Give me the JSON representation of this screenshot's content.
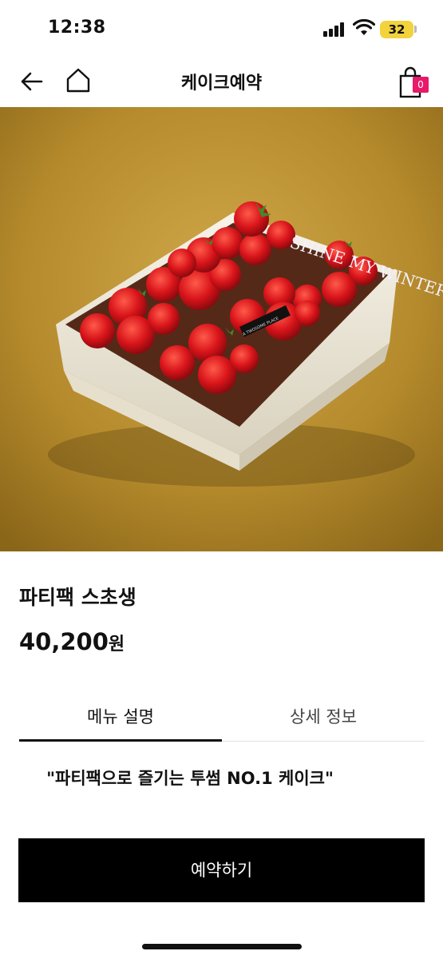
{
  "status_bar": {
    "time": "12:38",
    "battery": "32"
  },
  "nav": {
    "title": "케이크예약",
    "back_icon": "arrow-left-icon",
    "home_icon": "home-icon",
    "cart_icon": "shopping-bag-icon",
    "cart_count": "0"
  },
  "product": {
    "image_caption": "SHINE MY WINTER",
    "image_plaque": "A TWOSOME PLACE",
    "name": "파티팩 스초생",
    "price": "40,200",
    "price_unit": "원"
  },
  "tabs": [
    {
      "label": "메뉴 설명",
      "active": true
    },
    {
      "label": "상세 정보",
      "active": false
    }
  ],
  "description": "\"파티팩으로 즐기는 투썸 NO.1 케이크\"",
  "reserve_button": "예약하기",
  "colors": {
    "accent_badge": "#e8196b",
    "button_bg": "#000000",
    "battery": "#f2d33c"
  }
}
